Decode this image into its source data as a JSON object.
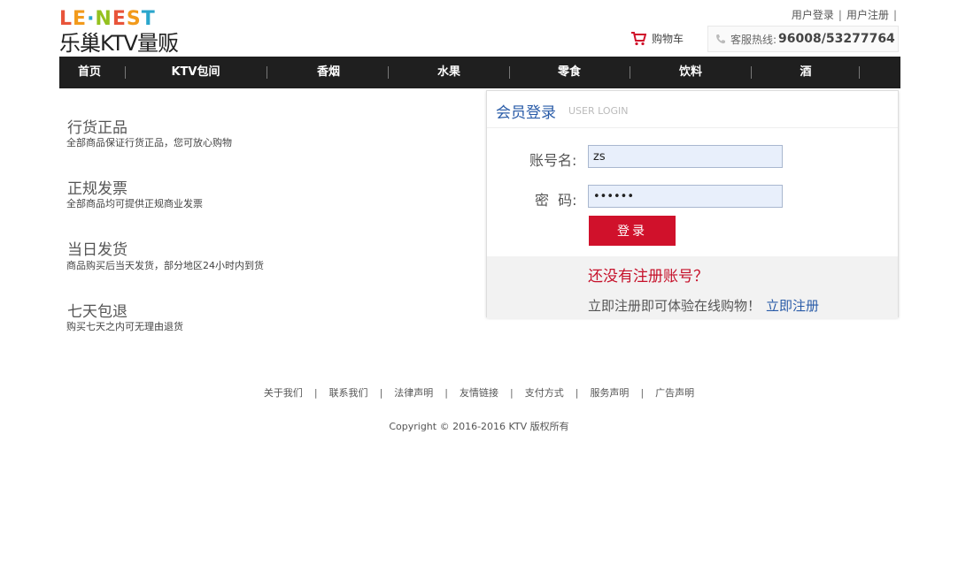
{
  "logo": {
    "top_letters": [
      {
        "char": "L",
        "color": "#e8543a"
      },
      {
        "char": "E",
        "color": "#f29a1b"
      },
      {
        "char": "·",
        "color": "#2aa6cc"
      },
      {
        "char": "N",
        "color": "#94c11f"
      },
      {
        "char": "E",
        "color": "#e8543a"
      },
      {
        "char": "S",
        "color": "#f29a1b"
      },
      {
        "char": "T",
        "color": "#2aa6cc"
      }
    ],
    "name": "乐巢KTV量贩"
  },
  "toplinks": {
    "login": "用户登录",
    "register": "用户注册",
    "sep": "|"
  },
  "cart": {
    "label": "购物车"
  },
  "hotline": {
    "label": "客服热线:",
    "number": "96008/53277764"
  },
  "nav": {
    "items": [
      "首页",
      "KTV包间",
      "香烟",
      "水果",
      "零食",
      "饮料",
      "酒"
    ],
    "sep": "|"
  },
  "features": [
    {
      "title": "行货正品",
      "desc": "全部商品保证行货正品，您可放心购物"
    },
    {
      "title": "正规发票",
      "desc": "全部商品均可提供正规商业发票"
    },
    {
      "title": "当日发货",
      "desc": "商品购买后当天发货，部分地区24小时内到货"
    },
    {
      "title": "七天包退",
      "desc": "购买七天之内可无理由退货"
    }
  ],
  "login": {
    "title": "会员登录",
    "subtitle": "USER LOGIN",
    "username_label": "账号名:",
    "username_value": "zs",
    "password_label": "密  码:",
    "password_value": "123456",
    "submit": "登录",
    "no_account": "还没有注册账号？",
    "register_prompt": "立即注册即可体验在线购物！",
    "register_link": "立即注册"
  },
  "footer": {
    "links": [
      "关于我们",
      "联系我们",
      "法律声明",
      "友情链接",
      "支付方式",
      "服务声明",
      "广告声明"
    ],
    "sep": "|",
    "copyright": "Copyright © 2016-2016 KTV 版权所有"
  },
  "colors": {
    "accent_red": "#d0112b",
    "link_blue": "#2a5ca8",
    "nav_bg": "#1f1f1f"
  }
}
